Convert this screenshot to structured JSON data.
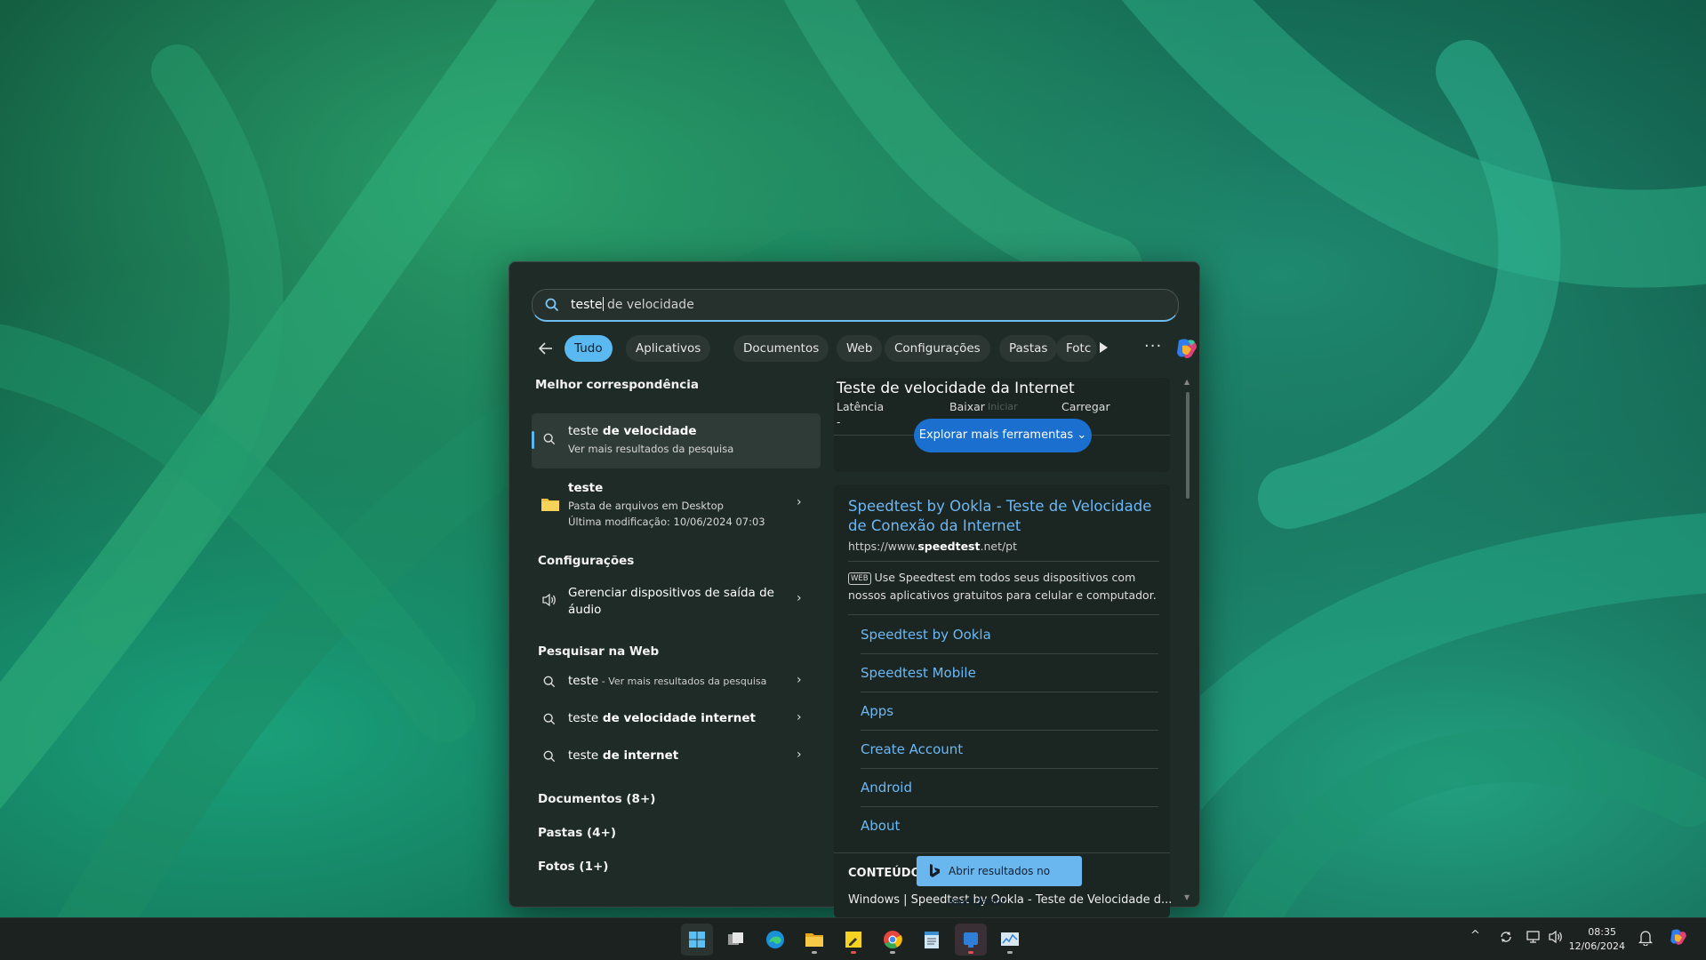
{
  "search": {
    "query_typed": "teste",
    "query_suggest": " de velocidade"
  },
  "filters": {
    "chips": [
      "Tudo",
      "Aplicativos",
      "Documentos",
      "Web",
      "Configurações",
      "Pastas",
      "Fotc"
    ],
    "active": "Tudo",
    "more": "···"
  },
  "left": {
    "best_match_heading": "Melhor correspondência",
    "best_match": {
      "title_plain": "teste",
      "title_bold": " de velocidade",
      "subtitle": "Ver mais resultados da pesquisa"
    },
    "folder": {
      "title": "teste",
      "line1": "Pasta de arquivos em Desktop",
      "line2": "Última modificação: 10/06/2024 07:03"
    },
    "settings_heading": "Configurações",
    "settings_item_line1": "Gerenciar dispositivos de saída de",
    "settings_item_line2": "áudio",
    "web_heading": "Pesquisar na Web",
    "web_items": [
      {
        "plain": "teste",
        "suffix": " - Ver mais resultados da pesquisa"
      },
      {
        "plain": "teste",
        "bold": " de velocidade internet"
      },
      {
        "plain": "teste",
        "bold": " de internet"
      }
    ],
    "documents": "Documentos (8+)",
    "folders": "Pastas (4+)",
    "photos": "Fotos (1+)"
  },
  "right": {
    "speedtest_title": "Teste de velocidade da Internet",
    "latency_label": "Latência",
    "latency_value": "-",
    "download_label": "Baixar",
    "start_label": "Iniciar",
    "upload_label": "Carregar",
    "explore_button": "Explorar mais ferramentas",
    "result_title_line1": "Speedtest by Ookla - Teste de Velocidade",
    "result_title_line2": "de Conexão da Internet",
    "url_prefix": "https://www.",
    "url_bold": "speedtest",
    "url_suffix": ".net/pt",
    "web_badge": "WEB",
    "snippet_line1": "Use Speedtest em todos seus dispositivos com",
    "snippet_line2": "nossos aplicativos gratuitos para celular e computador.",
    "sitelinks": [
      "Speedtest by Ookla",
      "Speedtest Mobile",
      "Apps",
      "Create Account",
      "Android",
      "About"
    ],
    "content_heading": "CONTEÚDO",
    "content_line": "Windows | Speedtest by Ookla - Teste de Velocidade d...",
    "open_browser": "Abrir resultados no navegador"
  },
  "taskbar": {
    "apps": [
      "start-icon",
      "task-view-icon",
      "edge-icon",
      "file-explorer-icon",
      "sticky-notes-icon",
      "chrome-icon",
      "notepad-icon",
      "app-icon",
      "resource-monitor-icon"
    ],
    "time": "08:35",
    "date": "12/06/2024"
  },
  "colors": {
    "accent": "#5ab9f0",
    "link": "#6cb8f5",
    "panel_bg": "#1f2b27"
  }
}
